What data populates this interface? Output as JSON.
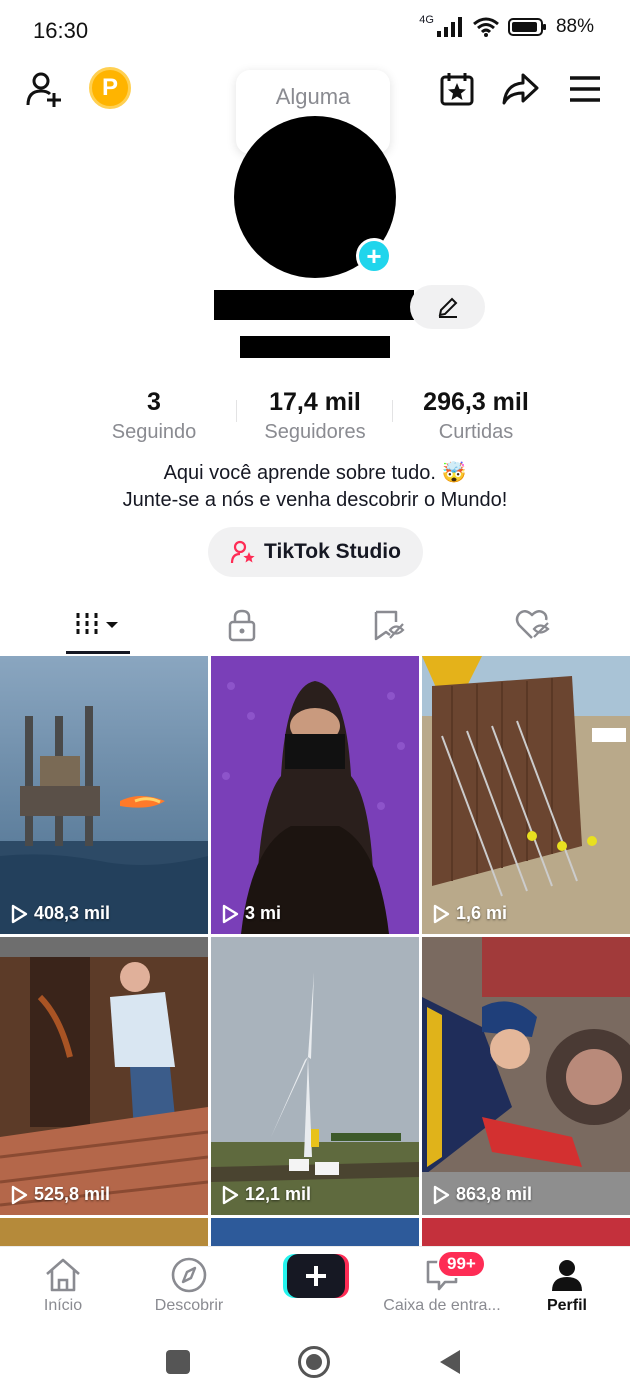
{
  "status": {
    "time": "16:30",
    "network": "4G",
    "battery": "88%"
  },
  "header": {
    "add_friend_icon": "person-plus-icon",
    "coin_label": "P",
    "note": "Alguma",
    "icons": [
      "calendar-star-icon",
      "share-icon",
      "menu-icon"
    ]
  },
  "stats": [
    {
      "value": "3",
      "label": "Seguindo"
    },
    {
      "value": "17,4 mil",
      "label": "Seguidores"
    },
    {
      "value": "296,3 mil",
      "label": "Curtidas"
    }
  ],
  "bio": {
    "line1": "Aqui você aprende sobre tudo. 🤯",
    "line2": "Junte-se a nós e venha descobrir o Mundo!"
  },
  "studio_button": "TikTok Studio",
  "tabs": [
    "videos-grid-icon",
    "lock-icon",
    "saved-icon",
    "liked-icon"
  ],
  "videos": [
    {
      "views": "408,3 mil"
    },
    {
      "views": "3 mi"
    },
    {
      "views": "1,6 mi"
    },
    {
      "views": "525,8 mil"
    },
    {
      "views": "12,1 mil"
    },
    {
      "views": "863,8 mil"
    }
  ],
  "nav": {
    "home": "Início",
    "discover": "Descobrir",
    "inbox": "Caixa de entra...",
    "inbox_badge": "99+",
    "profile": "Perfil"
  },
  "colors": {
    "accent": "#fe2c55",
    "cyan": "#20d5ec",
    "coin": "#ffb400"
  }
}
